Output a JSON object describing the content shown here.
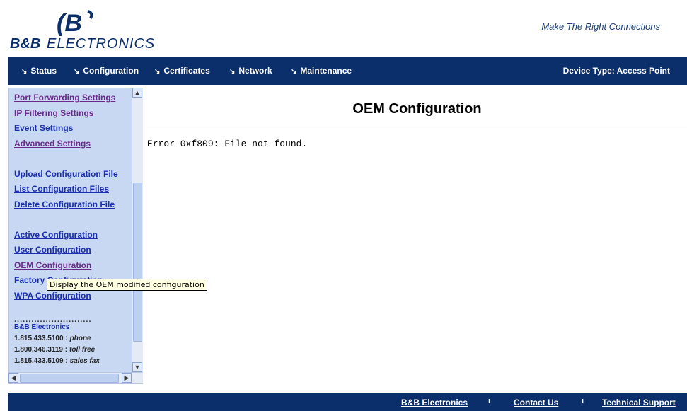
{
  "header": {
    "logo_brand": "B&B ELECTRONICS",
    "tagline": "Make The Right Connections"
  },
  "nav": {
    "items": [
      "Status",
      "Configuration",
      "Certificates",
      "Network",
      "Maintenance"
    ],
    "device_type": "Device Type: Access Point"
  },
  "sidebar": {
    "links": [
      {
        "label": "Port Forwarding Settings"
      },
      {
        "label": "IP Filtering Settings"
      },
      {
        "label": "Event Settings"
      },
      {
        "label": "Advanced Settings"
      },
      {
        "label": "Upload Configuration File"
      },
      {
        "label": "List Configuration Files"
      },
      {
        "label": "Delete Configuration File"
      },
      {
        "label": "Active Configuration"
      },
      {
        "label": "User Configuration"
      },
      {
        "label": "OEM Configuration"
      },
      {
        "label": "Factory Configuration"
      },
      {
        "label": "WPA Configuration"
      }
    ],
    "contact": {
      "company": "B&B Electronics",
      "rows": [
        {
          "number": "1.815.433.5100 :",
          "label": "phone"
        },
        {
          "number": "1.800.346.3119 :",
          "label": "toll free"
        },
        {
          "number": "1.815.433.5109 :",
          "label": "sales fax"
        }
      ]
    }
  },
  "main": {
    "title": "OEM Configuration",
    "error": "Error 0xf809: File not found."
  },
  "tooltip": "Display the OEM modified configuration",
  "footer": {
    "links": [
      "B&B Electronics",
      "Contact Us",
      "Technical Support"
    ]
  },
  "colors": {
    "nav_bg": "#0b2f6b",
    "sidebar_bg": "#c8d8f2",
    "link": "#1a2fb0",
    "visited_link": "#6a2a8a"
  }
}
